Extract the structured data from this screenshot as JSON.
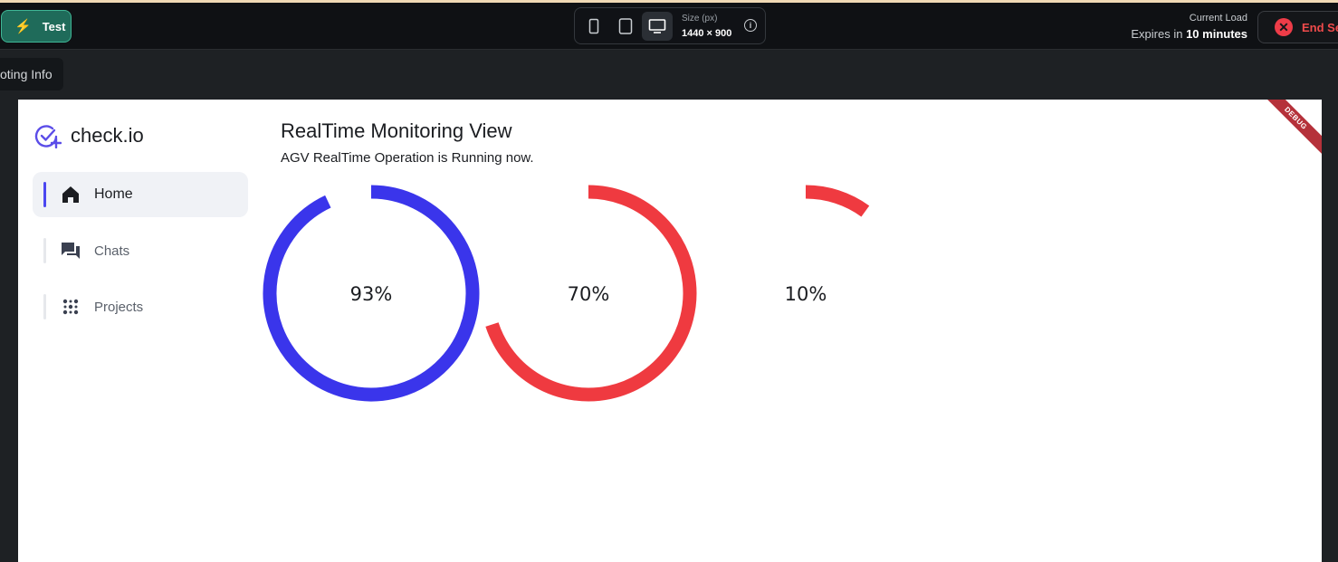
{
  "topbar": {
    "test_label": "Test",
    "size_label": "Size (px)",
    "size_value": "1440 × 900",
    "current_load_label": "Current Load",
    "expires_prefix": "Expires in",
    "expires_value": "10 minutes",
    "end_label": "End Se"
  },
  "tooltip": {
    "text": "oting Info"
  },
  "canvas": {
    "debug_banner": "DEBUG"
  },
  "sidebar": {
    "logo_text": "check.io",
    "items": [
      {
        "label": "Home",
        "icon": "home-icon",
        "active": true
      },
      {
        "label": "Chats",
        "icon": "chat-icon",
        "active": false
      },
      {
        "label": "Projects",
        "icon": "projects-icon",
        "active": false
      }
    ]
  },
  "main": {
    "title": "RealTime Monitoring View",
    "subtitle": "AGV RealTime Operation is Running now."
  },
  "gauges": [
    {
      "label": "93%",
      "value": 0.93,
      "color": "#3a35eb"
    },
    {
      "label": "70%",
      "value": 0.7,
      "color": "#ef3a40"
    },
    {
      "label": "10%",
      "value": 0.1,
      "color": "#ef3a40"
    }
  ],
  "colors": {
    "accent": "#4b47f0",
    "brand_green": "#1f6b5a",
    "danger": "#ee3c48"
  }
}
